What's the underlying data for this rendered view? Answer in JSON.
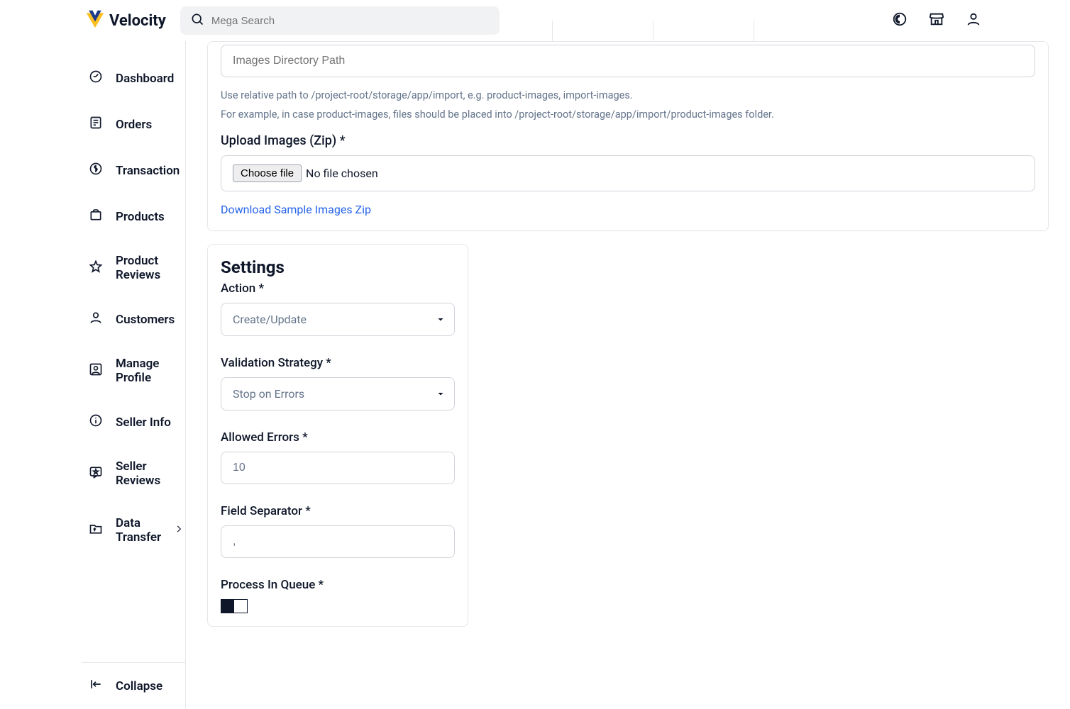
{
  "brand": "Velocity",
  "search_placeholder": "Mega Search",
  "sidebar": {
    "items": [
      {
        "label": "Dashboard"
      },
      {
        "label": "Orders"
      },
      {
        "label": "Transaction"
      },
      {
        "label": "Products"
      },
      {
        "label": "Product Reviews"
      },
      {
        "label": "Customers"
      },
      {
        "label": "Manage Profile"
      },
      {
        "label": "Seller Info"
      },
      {
        "label": "Seller Reviews"
      },
      {
        "label": "Data Transfer"
      }
    ],
    "collapse": "Collapse"
  },
  "images": {
    "path_placeholder": "Images Directory Path",
    "help1": "Use relative path to /project-root/storage/app/import, e.g. product-images, import-images.",
    "help2": "For example, in case product-images, files should be placed into /project-root/storage/app/import/product-images folder.",
    "upload_label": "Upload Images (Zip) *",
    "choose_file": "Choose file",
    "no_file": "No file chosen",
    "download_link": "Download Sample Images Zip"
  },
  "settings": {
    "title": "Settings",
    "action_label": "Action *",
    "action_value": "Create/Update",
    "validation_label": "Validation Strategy *",
    "validation_value": "Stop on Errors",
    "allowed_errors_label": "Allowed Errors *",
    "allowed_errors_value": "10",
    "field_sep_label": "Field Separator *",
    "field_sep_value": ",",
    "queue_label": "Process In Queue *"
  }
}
